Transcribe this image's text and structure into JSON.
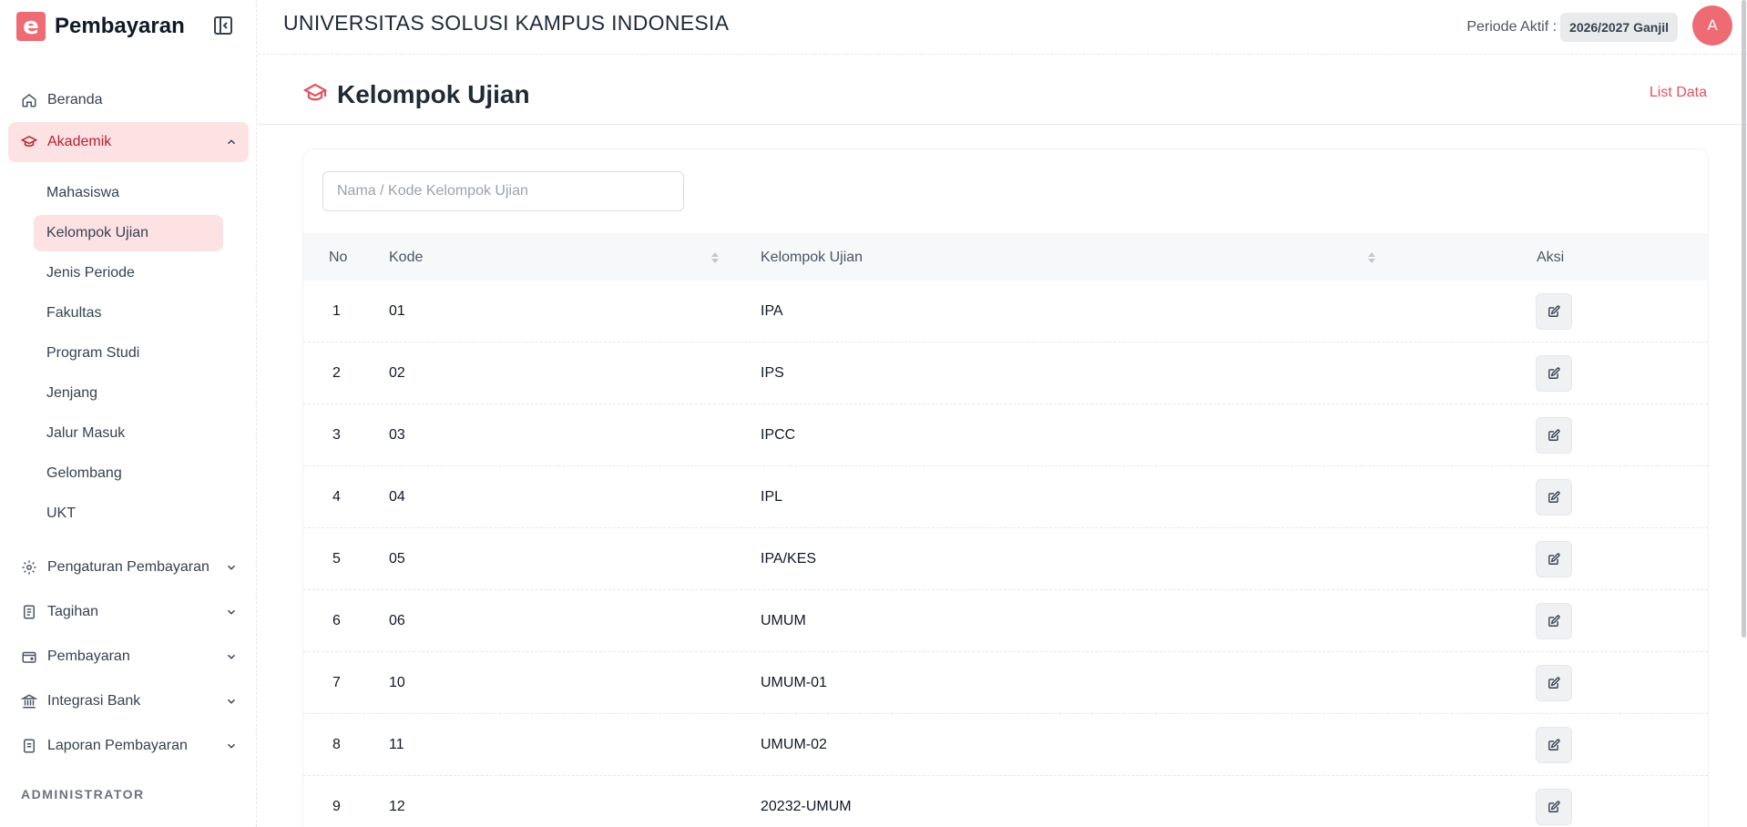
{
  "brand": {
    "logo_letter": "e",
    "title": "Pembayaran"
  },
  "sidebar": {
    "items": [
      {
        "label": "Beranda",
        "icon": "home-icon",
        "expandable": false
      },
      {
        "label": "Akademik",
        "icon": "graduation-cap-icon",
        "expandable": true,
        "expanded": true,
        "active": true
      },
      {
        "label": "Pengaturan Pembayaran",
        "icon": "settings-icon",
        "expandable": true
      },
      {
        "label": "Tagihan",
        "icon": "receipt-icon",
        "expandable": true
      },
      {
        "label": "Pembayaran",
        "icon": "wallet-icon",
        "expandable": true
      },
      {
        "label": "Integrasi Bank",
        "icon": "bank-icon",
        "expandable": true
      },
      {
        "label": "Laporan Pembayaran",
        "icon": "report-icon",
        "expandable": true
      }
    ],
    "akademik_subitems": [
      "Mahasiswa",
      "Kelompok Ujian",
      "Jenis Periode",
      "Fakultas",
      "Program Studi",
      "Jenjang",
      "Jalur Masuk",
      "Gelombang",
      "UKT"
    ],
    "active_subitem": "Kelompok Ujian",
    "section_label": "ADMINISTRATOR"
  },
  "header": {
    "university": "UNIVERSITAS SOLUSI KAMPUS INDONESIA",
    "periode_label": "Periode Aktif :",
    "periode_value": "2026/2027 Ganjil",
    "avatar_initial": "A"
  },
  "page": {
    "title": "Kelompok Ujian",
    "list_link": "List Data",
    "search_placeholder": "Nama / Kode Kelompok Ujian"
  },
  "table": {
    "columns": [
      "No",
      "Kode",
      "Kelompok Ujian",
      "Aksi"
    ],
    "rows": [
      {
        "no": "1",
        "kode": "01",
        "kelompok": "IPA"
      },
      {
        "no": "2",
        "kode": "02",
        "kelompok": "IPS"
      },
      {
        "no": "3",
        "kode": "03",
        "kelompok": "IPCC"
      },
      {
        "no": "4",
        "kode": "04",
        "kelompok": "IPL"
      },
      {
        "no": "5",
        "kode": "05",
        "kelompok": "IPA/KES"
      },
      {
        "no": "6",
        "kode": "06",
        "kelompok": "UMUM"
      },
      {
        "no": "7",
        "kode": "10",
        "kelompok": "UMUM-01"
      },
      {
        "no": "8",
        "kode": "11",
        "kelompok": "UMUM-02"
      },
      {
        "no": "9",
        "kode": "12",
        "kelompok": "20232-UMUM"
      }
    ]
  },
  "colors": {
    "accent": "#ef6b73",
    "active_bg": "#fde2e4",
    "link": "#e0535c"
  }
}
